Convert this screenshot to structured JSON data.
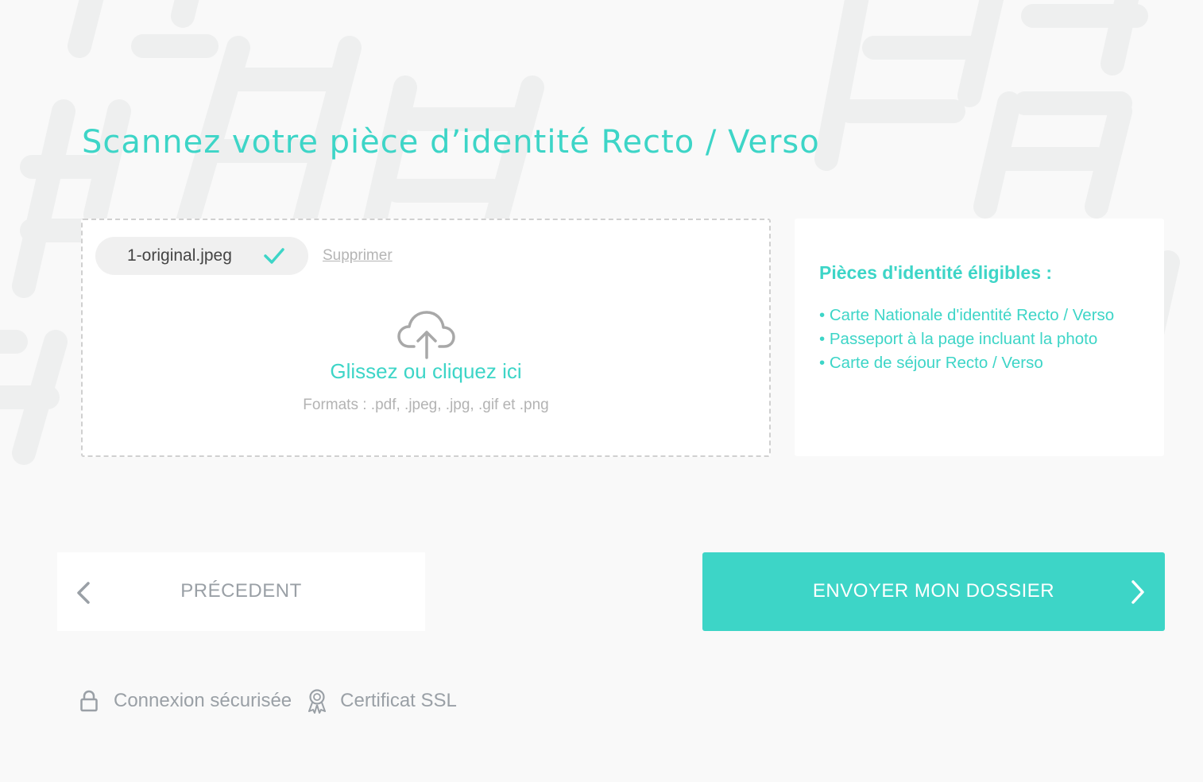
{
  "page": {
    "title": "Scannez votre pièce d’identité Recto / Verso"
  },
  "upload": {
    "file_name": "1-original.jpeg",
    "delete_label": "Supprimer",
    "drop_label": "Glissez ou cliquez ici",
    "formats_label": "Formats : .pdf, .jpeg, .jpg, .gif et .png"
  },
  "eligible": {
    "title": "Pièces d'identité éligibles :",
    "items": [
      "• Carte Nationale d'identité Recto / Verso",
      "• Passeport à la page incluant la photo",
      "• Carte de séjour Recto / Verso"
    ]
  },
  "navigation": {
    "prev_label": "PRÉCEDENT",
    "next_label": "ENVOYER MON DOSSIER"
  },
  "footer": {
    "secure_label": "Connexion sécurisée",
    "ssl_label": "Certificat SSL"
  },
  "icons": {
    "check": "check-icon",
    "upload": "cloud-upload-icon",
    "prev": "chevron-left-icon",
    "next": "chevron-right-icon",
    "lock": "lock-icon",
    "ssl": "certificate-icon"
  },
  "colors": {
    "accent": "#3dd5c7",
    "background": "#f9f9f9",
    "muted_text": "#9aa0a6"
  }
}
